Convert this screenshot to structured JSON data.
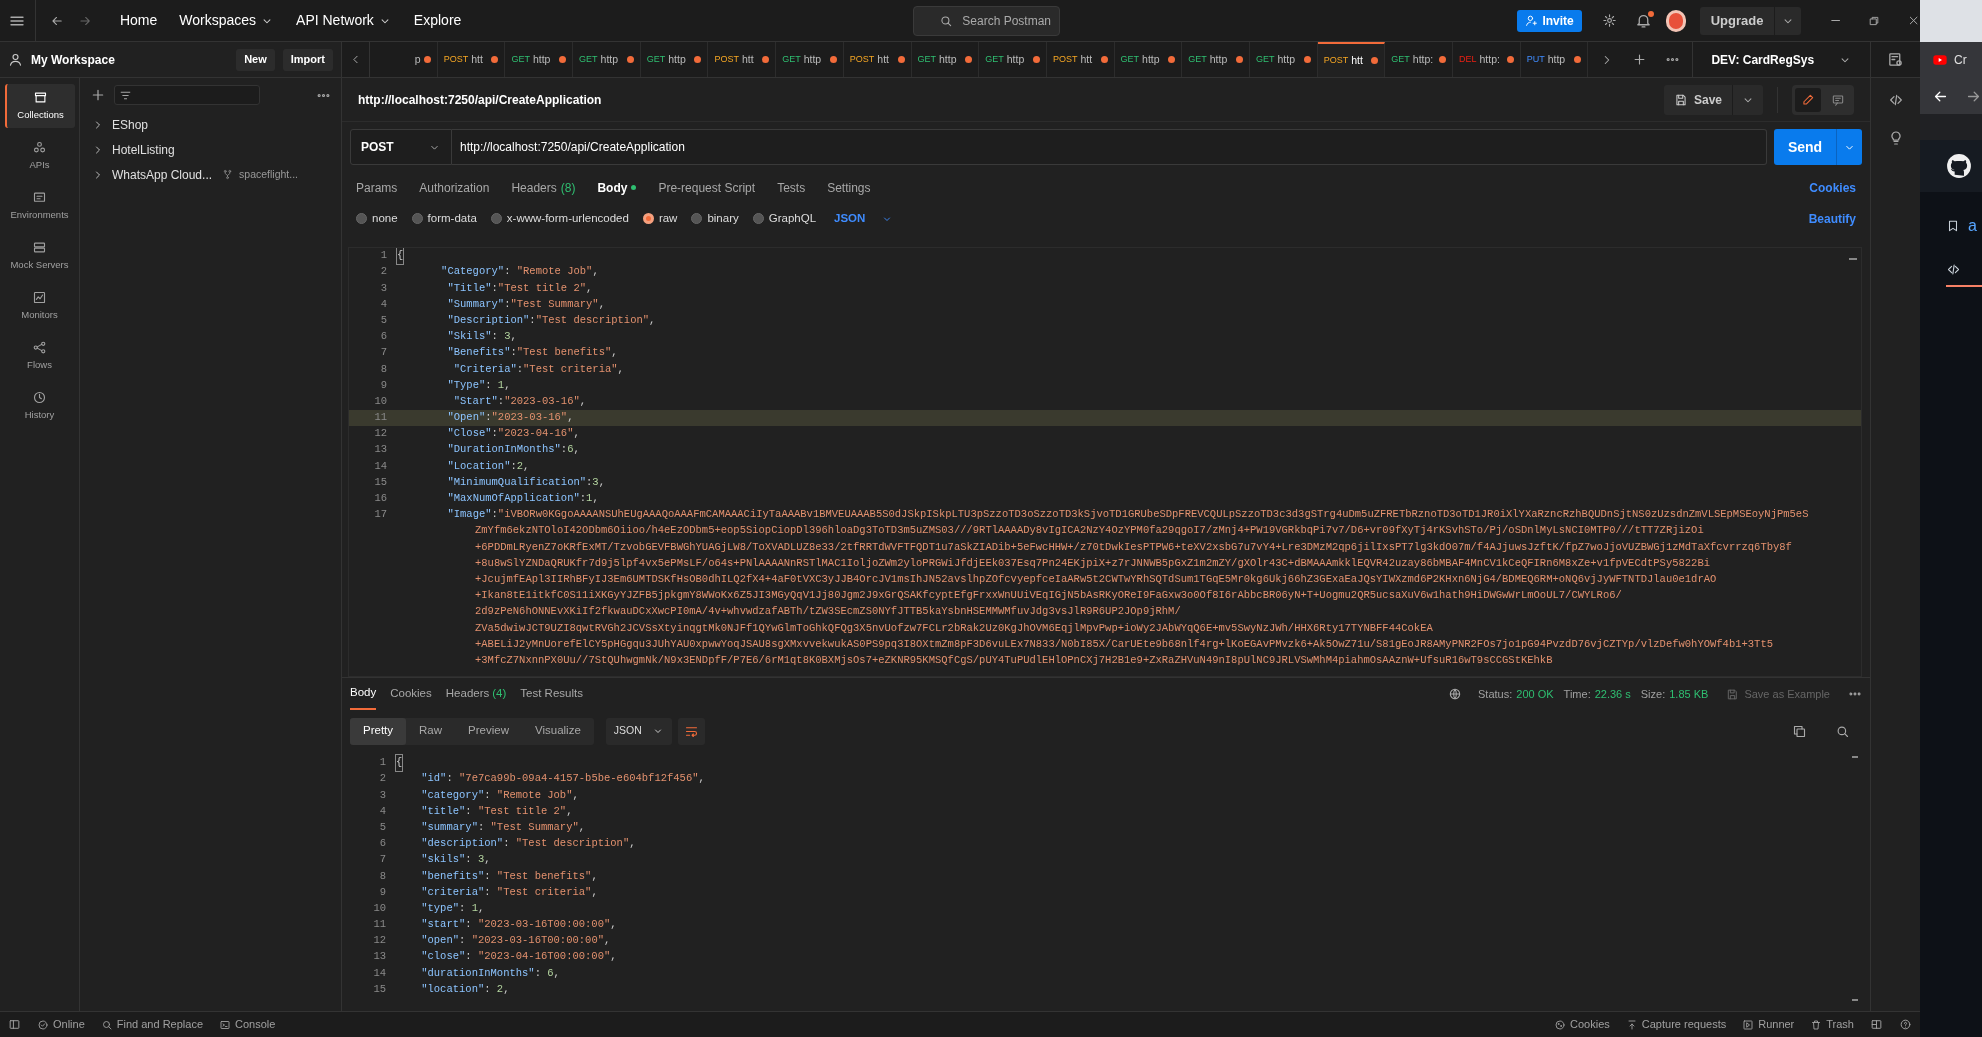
{
  "top_bar": {
    "nav": [
      {
        "label": "Home",
        "dropdown": false
      },
      {
        "label": "Workspaces",
        "dropdown": true
      },
      {
        "label": "API Network",
        "dropdown": true
      },
      {
        "label": "Explore",
        "dropdown": false
      }
    ],
    "search": {
      "placeholder": "Search Postman"
    },
    "invite": "Invite",
    "notification_badge": true,
    "upgrade": "Upgrade"
  },
  "workspace": {
    "title": "My Workspace",
    "buttons": [
      "New",
      "Import"
    ]
  },
  "nav_rail": [
    {
      "label": "Collections",
      "kind": "collections",
      "selected": true
    },
    {
      "label": "APIs",
      "kind": "apis",
      "selected": false
    },
    {
      "label": "Environments",
      "kind": "environments",
      "selected": false
    },
    {
      "label": "Mock Servers",
      "kind": "mock_servers",
      "selected": false
    },
    {
      "label": "Monitors",
      "kind": "monitors",
      "selected": false
    },
    {
      "label": "Flows",
      "kind": "flows",
      "selected": false
    },
    {
      "label": "History",
      "kind": "history",
      "selected": false
    }
  ],
  "collections": [
    {
      "label": "EShop"
    },
    {
      "label": "HotelListing"
    },
    {
      "label": "WhatsApp Cloud...",
      "fork_label": "spaceflight..."
    }
  ],
  "request_tabs": [
    {
      "kind": "none",
      "label": "p",
      "unsaved": true,
      "selected": false
    },
    {
      "kind": "post",
      "method": "POST",
      "label": "htt",
      "unsaved": true,
      "selected": false
    },
    {
      "kind": "get",
      "method": "GET",
      "label": "http",
      "unsaved": true,
      "selected": false
    },
    {
      "kind": "get",
      "method": "GET",
      "label": "http",
      "unsaved": true,
      "selected": false
    },
    {
      "kind": "get",
      "method": "GET",
      "label": "http",
      "unsaved": true,
      "selected": false
    },
    {
      "kind": "post",
      "method": "POST",
      "label": "htt",
      "unsaved": true,
      "selected": false
    },
    {
      "kind": "get",
      "method": "GET",
      "label": "http",
      "unsaved": true,
      "selected": false
    },
    {
      "kind": "post",
      "method": "POST",
      "label": "htt",
      "unsaved": true,
      "selected": false
    },
    {
      "kind": "get",
      "method": "GET",
      "label": "http",
      "unsaved": true,
      "selected": false
    },
    {
      "kind": "get",
      "method": "GET",
      "label": "http",
      "unsaved": true,
      "selected": false
    },
    {
      "kind": "post",
      "method": "POST",
      "label": "htt",
      "unsaved": true,
      "selected": false
    },
    {
      "kind": "get",
      "method": "GET",
      "label": "http",
      "unsaved": true,
      "selected": false
    },
    {
      "kind": "get",
      "method": "GET",
      "label": "http",
      "unsaved": true,
      "selected": false
    },
    {
      "kind": "get",
      "method": "GET",
      "label": "http",
      "unsaved": true,
      "selected": false
    },
    {
      "kind": "post",
      "method": "POST",
      "label": "htt",
      "unsaved": true,
      "selected": true
    },
    {
      "kind": "get",
      "method": "GET",
      "label": "http:",
      "unsaved": true,
      "selected": false
    },
    {
      "kind": "delete",
      "method": "DEL",
      "label": "http:",
      "unsaved": true,
      "selected": false
    },
    {
      "kind": "put",
      "method": "PUT",
      "label": "http",
      "unsaved": true,
      "selected": false
    }
  ],
  "environment": "DEV: CardRegSys",
  "request": {
    "title": "http://localhost:7250/api/CreateApplication",
    "save": "Save",
    "method": "POST",
    "url": "http://localhost:7250/api/CreateApplication",
    "send": "Send",
    "tabs": [
      {
        "label": "Params",
        "selected": false
      },
      {
        "label": "Authorization",
        "selected": false
      },
      {
        "label": "Headers",
        "count": "(8)",
        "selected": false
      },
      {
        "label": "Body",
        "indicator": true,
        "selected": true
      },
      {
        "label": "Pre-request Script",
        "selected": false
      },
      {
        "label": "Tests",
        "selected": false
      },
      {
        "label": "Settings",
        "selected": false
      }
    ],
    "cookies": "Cookies",
    "body_modes": [
      {
        "label": "none",
        "selected": false
      },
      {
        "label": "form-data",
        "selected": false
      },
      {
        "label": "x-www-form-urlencoded",
        "selected": false
      },
      {
        "label": "raw",
        "selected": true
      },
      {
        "label": "binary",
        "selected": false
      },
      {
        "label": "GraphQL",
        "selected": false
      }
    ],
    "language": "JSON",
    "beautify": "Beautify",
    "body_lines": [
      {
        "number": "1",
        "text": "{",
        "current": false
      },
      {
        "number": "2",
        "text": "       \"Category\": \"Remote Job\",",
        "current": false
      },
      {
        "number": "3",
        "text": "        \"Title\":\"Test title 2\",",
        "current": false
      },
      {
        "number": "4",
        "text": "        \"Summary\":\"Test Summary\",",
        "current": false
      },
      {
        "number": "5",
        "text": "        \"Description\":\"Test description\",",
        "current": false
      },
      {
        "number": "6",
        "text": "        \"Skils\": 3,",
        "current": false
      },
      {
        "number": "7",
        "text": "        \"Benefits\":\"Test benefits\",",
        "current": false
      },
      {
        "number": "8",
        "text": "         \"Criteria\":\"Test criteria\",",
        "current": false
      },
      {
        "number": "9",
        "text": "        \"Type\": 1,",
        "current": false
      },
      {
        "number": "10",
        "text": "         \"Start\":\"2023-03-16\",",
        "current": false
      },
      {
        "number": "11",
        "text": "        \"Open\":\"2023-03-16\",",
        "current": true
      },
      {
        "number": "12",
        "text": "        \"Close\":\"2023-04-16\",",
        "current": false
      },
      {
        "number": "13",
        "text": "        \"DurationInMonths\":6,",
        "current": false
      },
      {
        "number": "14",
        "text": "        \"Location\":2,",
        "current": false
      },
      {
        "number": "15",
        "text": "        \"MinimumQualification\":3,",
        "current": false
      },
      {
        "number": "16",
        "text": "        \"MaxNumOfApplication\":1,",
        "current": false
      },
      {
        "number": "17",
        "text": "        \"Image\":\"iVBORw0KGgoAAAANSUhEUgAAAQoAAAFmCAMAAACiIyTaAAABv1BMVEUAAAB5S0dJSkpISkpLTU3pSzzoTD3oSzzoTD3kSjvoTD1GRUbeSDpFREVCQULpSzzoTD3c3d3gSTrg4uDm5uZFRETbRznoTD3oTD1JR0iXlYXaRzncRzhBQUDnSjtNS0zUzsdnZmVLSEpMSEoyNjPm5eS",
        "current": false,
        "wrapped": [
          "ZmYfm6ekzNTOloI42ODbm6Oiioo/h4eEzODbm5+eop5SiopCiopDl396hloaDg3ToTD3m5uZMS03///9RTlAAAADy8vIgICA2NzY4OzYPM0fa29qgoI7/zMnj4+PW19VGRkbqPi7v7/D6+vr09fXyTj4rKSvhSTo/Pj/oSDnlMyLsNCI0MTP0///tTT7ZRjizOi",
          "+6PDDmLRyenZ7oKRfExMT/TzvobGEVFBWGhYUAGjLW8/ToXVADLUZ8e33/2tfRRTdWVFTFQDT1u7aSkZIADib+5eFwcHHW+/z70tDwkIesPTPW6+teXV2xsbG7u7vY4+Lre3DMzM2qp6jilIxsPT7lg3kdO07m/f4AJjuwsJzftK/fpZ7woJjoVUZBWGj1zMdTaXfcvrrzq6Tby8f",
          "+8u8wSlYZNDaQRUKfr7d9j5lpf4vx5ePMsLF/o64s+PNlAAAANnRSTlMAC1IoljoZWm2yloPRGWiJfdjEEk037Esq7Pn24EKjpiX+z7rJNNWB5pGxZ1m2mZY/gXOlr43C+dBMAAAmkklEQVR42uzay86bMBAF4MnCV1kCeQFIRn6M8xZe+v1fpVECdtPSy5822Bi",
          "+JcujmfEApl3IIRhBFyIJ3Em6UMTDSKfHsOB0dhILQ2fX4+4aF0tVXC3yJJB4OrcJV1msIhJN52avslhpZOfcvyepfceIaARw5t2CWTwYRhSQTdSum1TGqE5Mr0kg6Ukj66hZ3GExaEaJQsYIWXzmd6P2KHxn6NjG4/BDMEQ6RM+oNQ6vjJyWFTNTDJlau0e1drAO",
          "+Ikan8tE1itkfC0S11iXKGyYJZFB5jpkgmY8WWoKx6Z5JI3MGyQqV1Jj80Jgm2J9xGrQSAKfcyptEfgFrxxWnUUiVEqIGjN5bAsRKyOReI9FaGxw3o0Of8I6rAbbcBR06yN+T+Uogmu2QR5ucsaXuV6w1hath9HiDWGwWrLmOoUL7/CWYLRo6/",
          "2d9zPeN6hONNEvXKiIf2fkwauDCxXwcPI0mA/4v+whvwdzafABTh/tZW3SEcmZS0NYfJTTB5kaYsbnHSEMMWMfuvJdg3vsJlR9R6UP2JOp9jRhM/",
          "ZVa5dwiwJCT9UZI8qwtRVGh2JCVSsXtyinqgtMk0NJFf1QYwGlmToGhkQFQg3X5nvUofzw7FCLr2bRak2Uz0KgJhOVM6EqjlMpvPwp+ioWy2JAbWYqQ6E+mv5SwyNzJWh/HHX6Rty17TYNBFF44CokEA",
          "+ABELiJ2yMnUorefElCY5pHGgqu3JUhYAU0xpwwYoqJSAU8sgXMxvvekwukAS0PS9pq3I8OXtmZm8pF3D6vuLEx7N833/N0bI85X/CarUEte9b68nlf4rg+lKoEGAvPMvzk6+Ak5OwZ71u/S81gEoJR8AMyPNR2FOs7jo1pG94PvzdD76vjCZTYp/vlzDefw0hYOWf4b1+3Tt5",
          "+3MfcZ7NxnnPX0Uu//7StQUhwgmNk/N9x3ENDpfF/P7E6/6rM1qt8K0BXMjsOs7+eZKNR95KMSQfCgS/pUY4TuPUdlEHlOPnCXj7H2B1e9+ZxRaZHVuN49nI8pUlNC9JRLVSwMhM4piahmOsAAznW+UfsuR16wT9sCCGStKEhkB"
        ]
      }
    ]
  },
  "response": {
    "tabs": [
      {
        "label": "Body",
        "selected": true
      },
      {
        "label": "Cookies",
        "selected": false
      },
      {
        "label": "Headers",
        "count": "(4)",
        "selected": false
      },
      {
        "label": "Test Results",
        "selected": false
      }
    ],
    "status_label": "Status:",
    "status": "200 OK",
    "time_label": "Time:",
    "time": "22.36 s",
    "size_label": "Size:",
    "size": "1.85 KB",
    "save_example": "Save as Example",
    "views": [
      {
        "label": "Pretty",
        "selected": true
      },
      {
        "label": "Raw",
        "selected": false
      },
      {
        "label": "Preview",
        "selected": false
      },
      {
        "label": "Visualize",
        "selected": false
      }
    ],
    "language": "JSON",
    "lines": [
      {
        "number": "1",
        "text": "{"
      },
      {
        "number": "2",
        "text": "    \"id\": \"7e7ca99b-09a4-4157-b5be-e604bf12f456\","
      },
      {
        "number": "3",
        "text": "    \"category\": \"Remote Job\","
      },
      {
        "number": "4",
        "text": "    \"title\": \"Test title 2\","
      },
      {
        "number": "5",
        "text": "    \"summary\": \"Test Summary\","
      },
      {
        "number": "6",
        "text": "    \"description\": \"Test description\","
      },
      {
        "number": "7",
        "text": "    \"skils\": 3,"
      },
      {
        "number": "8",
        "text": "    \"benefits\": \"Test benefits\","
      },
      {
        "number": "9",
        "text": "    \"criteria\": \"Test criteria\","
      },
      {
        "number": "10",
        "text": "    \"type\": 1,"
      },
      {
        "number": "11",
        "text": "    \"start\": \"2023-03-16T00:00:00\","
      },
      {
        "number": "12",
        "text": "    \"open\": \"2023-03-16T00:00:00\","
      },
      {
        "number": "13",
        "text": "    \"close\": \"2023-04-16T00:00:00\","
      },
      {
        "number": "14",
        "text": "    \"durationInMonths\": 6,"
      },
      {
        "number": "15",
        "text": "    \"location\": 2,"
      }
    ]
  },
  "status_bar": {
    "left": [
      {
        "label": "Online",
        "kind": "online"
      },
      {
        "label": "Find and Replace",
        "kind": "search"
      },
      {
        "label": "Console",
        "kind": "console"
      }
    ],
    "right": [
      {
        "label": "Cookies",
        "kind": "cookie"
      },
      {
        "label": "Capture requests",
        "kind": "capture"
      },
      {
        "label": "Runner",
        "kind": "runner"
      },
      {
        "label": "Trash",
        "kind": "trash"
      }
    ]
  },
  "browser_behind": {
    "tab_text": "Cr",
    "link_text": "a"
  }
}
